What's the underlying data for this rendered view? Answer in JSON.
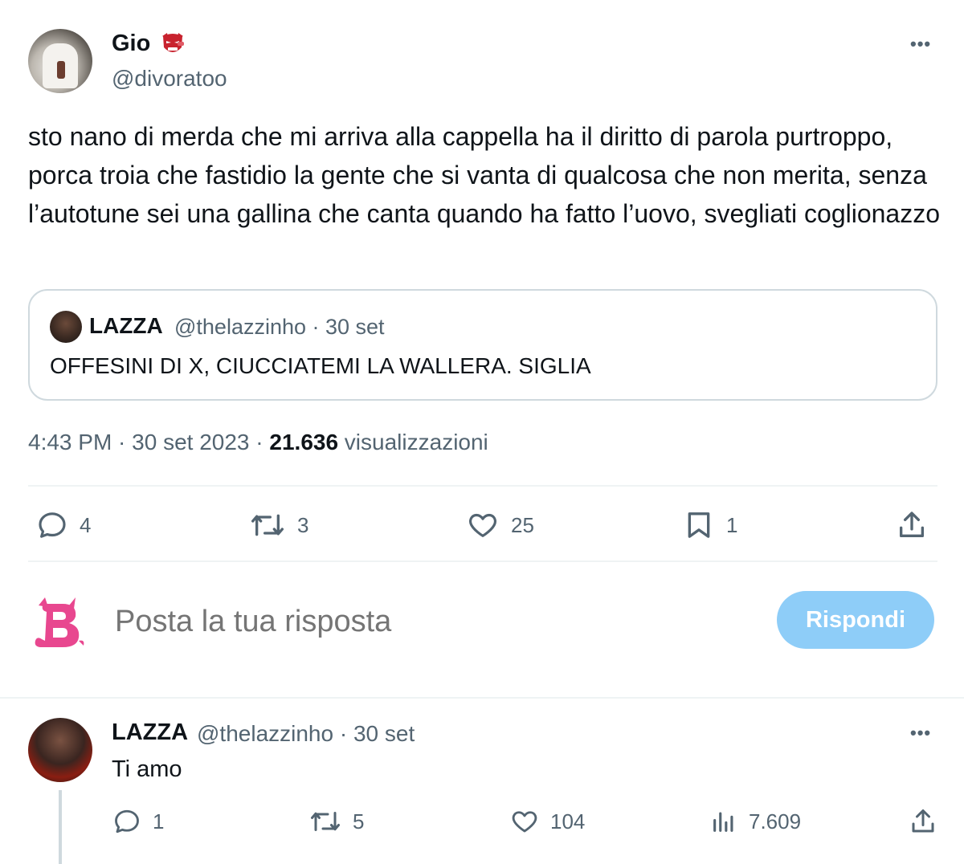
{
  "tweet": {
    "author_name": "Gio",
    "author_handle": "@divoratoo",
    "text": "sto nano di merda che mi arriva alla cappella ha il diritto di parola purtroppo, porca troia che fastidio la gente che si vanta di qualcosa che non merita, senza l’autotune sei una gallina che canta quando ha fatto l’uovo, svegliati coglionazzo",
    "more_label": "•••",
    "quoted": {
      "name": "LAZZA",
      "handle_date": "@thelazzinho · 30 set",
      "text": "OFFESINI DI X, CIUCCIATEMI LA WALLERA. SIGLIA"
    },
    "timestamp": "4:43 PM · 30 set 2023 · ",
    "views_count": "21.636",
    "views_label": " visualizzazioni",
    "actions": {
      "replies": "4",
      "retweets": "3",
      "likes": "25",
      "bookmarks": "1"
    }
  },
  "reply_box": {
    "placeholder": "Posta la tua risposta",
    "button_label": "Rispondi"
  },
  "reply": {
    "name": "LAZZA",
    "handle_date": "@thelazzinho · 30 set",
    "text": "Ti amo",
    "more_label": "•••",
    "actions": {
      "replies": "1",
      "retweets": "5",
      "likes": "104",
      "views": "7.609"
    }
  },
  "colors": {
    "text": "#0f1419",
    "secondary": "#536471",
    "border": "#cfd9de",
    "button_disabled": "#8ecdf8",
    "logo_pink": "#e8478f"
  },
  "icons": [
    "more-icon",
    "reply-icon",
    "retweet-icon",
    "like-icon",
    "bookmark-icon",
    "share-icon",
    "views-icon",
    "red-mask-emoji",
    "b-logo-icon"
  ]
}
